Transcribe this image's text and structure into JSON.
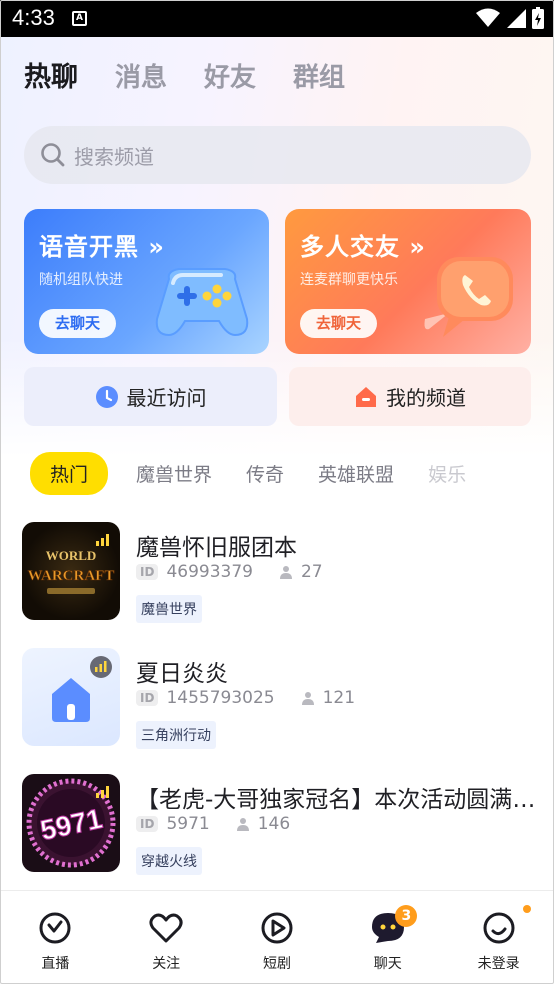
{
  "status_bar": {
    "time": "4:33",
    "notification_icon": "A"
  },
  "top_tabs": [
    {
      "label": "热聊",
      "active": true
    },
    {
      "label": "消息",
      "active": false
    },
    {
      "label": "好友",
      "active": false
    },
    {
      "label": "群组",
      "active": false
    }
  ],
  "search": {
    "placeholder": "搜索频道"
  },
  "banners": [
    {
      "title": "语音开黑 »",
      "subtitle": "随机组队快进",
      "button": "去聊天",
      "icon": "gamepad-icon"
    },
    {
      "title": "多人交友 »",
      "subtitle": "连麦群聊更快乐",
      "button": "去聊天",
      "icon": "phone-bubble-icon"
    }
  ],
  "quick_links": [
    {
      "label": "最近访问",
      "icon": "clock-icon"
    },
    {
      "label": "我的频道",
      "icon": "home-icon"
    }
  ],
  "categories": [
    "热门",
    "魔兽世界",
    "传奇",
    "英雄联盟",
    "娱乐"
  ],
  "active_category": 0,
  "channels": [
    {
      "title": "魔兽怀旧服团本",
      "id_tag": "ID",
      "id": "46993379",
      "members": "27",
      "tag": "魔兽世界",
      "thumb_text": "WORLD WARCRAFT"
    },
    {
      "title": "夏日炎炎",
      "id_tag": "ID",
      "id": "1455793025",
      "members": "121",
      "tag": "三角洲行动",
      "thumb_text": ""
    },
    {
      "title": "【老虎-大哥独家冠名】本次活动圆满结束",
      "id_tag": "ID",
      "id": "5971",
      "members": "146",
      "tag": "穿越火线",
      "thumb_text": "5971"
    }
  ],
  "bottom_nav": [
    {
      "label": "直播",
      "icon": "live-icon"
    },
    {
      "label": "关注",
      "icon": "heart-icon"
    },
    {
      "label": "短剧",
      "icon": "play-icon"
    },
    {
      "label": "聊天",
      "icon": "chat-icon",
      "badge": "3"
    },
    {
      "label": "未登录",
      "icon": "profile-icon"
    }
  ],
  "colors": {
    "accent_yellow": "#ffde00",
    "badge_orange": "#ff9d1c",
    "banner_blue": "#3c7dfb",
    "banner_orange": "#ff7a5a"
  }
}
